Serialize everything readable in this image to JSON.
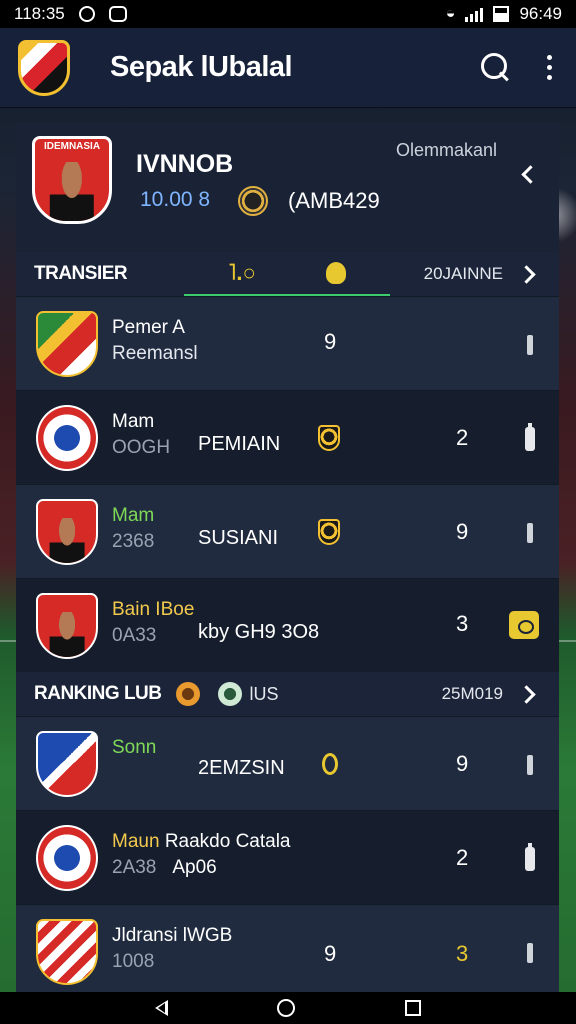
{
  "status_bar": {
    "time_left": "118:35",
    "time_right": "96:49"
  },
  "app_bar": {
    "title": "Sepak lUbalal"
  },
  "profile": {
    "crest_caption": "IDEMNASIA",
    "name": "IVNNOB",
    "value": "10.00 8",
    "code": "(AMB429",
    "label": "Olemmakanl"
  },
  "transfer_section": {
    "title": "TRANSIER",
    "tab1": " .ʘ",
    "right_label": "20JAINNE"
  },
  "transfer_rows": [
    {
      "line1": "Pemer A",
      "line1_accent": "A",
      "line2": "Reemansl",
      "value": "9"
    },
    {
      "line1": "Mam",
      "line2_sub": "OOGH",
      "line2": "PEMIAIN",
      "value": "2"
    },
    {
      "line1": "Mam",
      "line2_sub": "2368",
      "line2": "SUSIANI",
      "value": "9"
    },
    {
      "line1": "Bain IBoe",
      "line2_sub": "0A33",
      "line2": "kby GH9 3O8",
      "value": "3"
    }
  ],
  "ranking_section": {
    "title": "RANKING LUB",
    "mid_label": "lUS",
    "right_label": "25M019"
  },
  "ranking_rows": [
    {
      "line1": "Sonn",
      "line2": "2EMZSIN",
      "value": "9"
    },
    {
      "line1": "Maun",
      "line1_extra": "Raakdo Catala",
      "line2_sub": "2A38",
      "line2": "Ap06",
      "value": "2"
    },
    {
      "line1": "Jldransi lWGB",
      "line2_sub": "1008",
      "value": "9",
      "value2": "3"
    }
  ],
  "colors": {
    "accent_green": "#3ccc6e",
    "accent_yellow": "#e8c830",
    "panel": "#1b2438"
  }
}
